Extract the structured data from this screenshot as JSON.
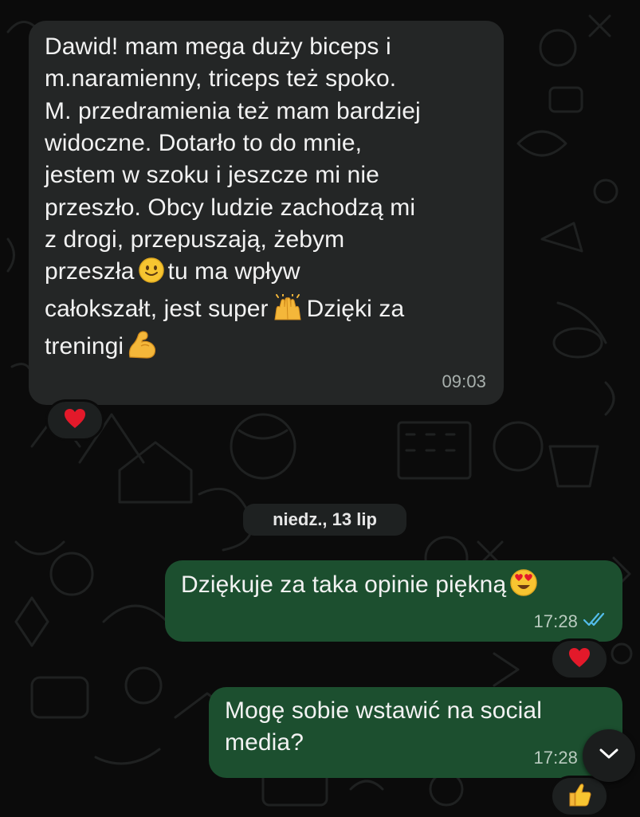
{
  "messages": [
    {
      "direction": "incoming",
      "line1": "Dawid! mam mega duży biceps i",
      "line2": "m.naramienny, triceps też spoko.",
      "line3": "M. przedramienia też mam bardziej",
      "line4": "widoczne. Dotarło to do mnie,",
      "line5": "jestem w szoku i jeszcze mi nie",
      "line6": "przeszło. Obcy ludzie zachodzą mi",
      "line7": "z drogi, przepuszają, żebym",
      "line8a": "przeszła",
      "line8b": "tu ma wpływ",
      "line9a": "całokszałt, jest super",
      "line9b": "Dzięki za",
      "line10": "treningi",
      "time": "09:03",
      "reaction": "red-heart"
    },
    {
      "direction": "outgoing",
      "text": "Dziękuje za taka opinie piękną",
      "time": "17:28",
      "status": "read",
      "reaction": "red-heart"
    },
    {
      "direction": "outgoing",
      "line1": "Mogę sobie wstawić na social",
      "line2": "media?",
      "time": "17:28",
      "status": "read",
      "reaction": "thumbs-up"
    }
  ],
  "date_separator": "niedz., 13 lip",
  "scroll_button_icon": "chevron-down-icon",
  "colors": {
    "background": "#0b0b0b",
    "incoming_bubble": "#242626",
    "outgoing_bubble": "#1c4f2f",
    "read_ticks": "#53bdeb"
  }
}
